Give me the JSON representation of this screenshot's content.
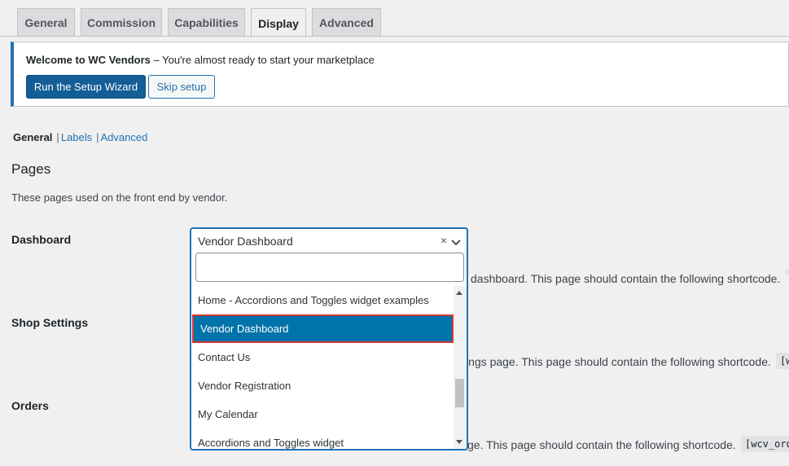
{
  "tabs": [
    "General",
    "Commission",
    "Capabilities",
    "Display",
    "Advanced"
  ],
  "notice": {
    "title": "Welcome to WC Vendors",
    "dash": " – ",
    "message": "You're almost ready to start your marketplace",
    "primary_button": "Run the Setup Wizard",
    "secondary_button": "Skip setup"
  },
  "subnav": {
    "current": "General",
    "links": [
      "Labels",
      "Advanced"
    ],
    "separator": "|"
  },
  "section": {
    "title": "Pages",
    "description": "These pages used on the front end by vendor."
  },
  "fields": [
    {
      "label": "Dashboard",
      "help": "dashboard. This page should contain the following shortcode.",
      "code": ""
    },
    {
      "label": "Shop Settings",
      "help": "ings page. This page should contain the following shortcode.",
      "code": "[w"
    },
    {
      "label": "Orders",
      "help": "ge. This page should contain the following shortcode.",
      "code": "[wcv_ord"
    }
  ],
  "dropdown": {
    "selected": "Vendor Dashboard",
    "clear": "×",
    "search_value": "",
    "options": [
      "Home - Accordions and Toggles widget examples",
      "Vendor Dashboard",
      "Contact Us",
      "Vendor Registration",
      "My Calendar",
      "Accordions and Toggles widget"
    ],
    "highlighted_index": 1
  },
  "colors": {
    "accent": "#2271b1",
    "highlight": "#0073aa",
    "highlight_border": "#d63638",
    "primary_button": "#135e96"
  },
  "icons": {
    "clear": "close-icon",
    "toggle": "chevron-down-icon"
  }
}
